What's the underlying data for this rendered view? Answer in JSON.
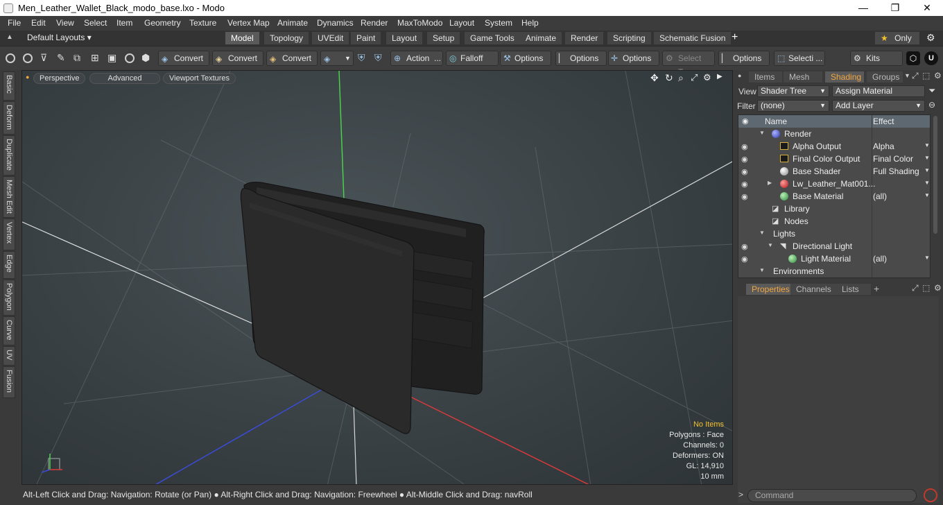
{
  "window": {
    "title": "Men_Leather_Wallet_Black_modo_base.lxo - Modo",
    "minimize": "—",
    "maximize": "❐",
    "close": "✕"
  },
  "menu": [
    "File",
    "Edit",
    "View",
    "Select",
    "Item",
    "Geometry",
    "Texture",
    "Vertex Map",
    "Animate",
    "Dynamics",
    "Render",
    "MaxToModo",
    "Layout",
    "System",
    "Help"
  ],
  "layouts": {
    "dropdown": "Default Layouts ▾",
    "tabs": [
      "Model",
      "Topology",
      "UVEdit",
      "Paint",
      "Layout",
      "Setup",
      "Game Tools",
      "Animate",
      "Render",
      "Scripting",
      "Schematic Fusion"
    ],
    "active": "Model",
    "add": "+",
    "only": "Only",
    "star": "★"
  },
  "toolbar": {
    "convert1": "Convert",
    "convert2": "Convert",
    "convert3": "Convert",
    "action": "Action",
    "action_more": "...",
    "falloff": "Falloff",
    "options1": "Options",
    "options2": "Options",
    "options3": "Options",
    "select_t": "Select T...",
    "options4": "Options",
    "selecti": "Selecti ...",
    "kits": "Kits"
  },
  "left_tabs": [
    "Basic",
    "Deform",
    "Duplicate",
    "Mesh Edit",
    "Vertex",
    "Edge",
    "Polygon",
    "Curve",
    "UV",
    "Fusion"
  ],
  "viewport": {
    "perspective": "Perspective",
    "advanced": "Advanced",
    "textures": "Viewport Textures",
    "info": {
      "no_items": "No Items",
      "polygons": "Polygons : Face",
      "channels": "Channels: 0",
      "deformers": "Deformers: ON",
      "gl": "GL: 14,910",
      "scale": "10 mm"
    }
  },
  "status": "Alt-Left Click and Drag: Navigation: Rotate (or Pan) ● Alt-Right Click and Drag: Navigation: Freewheel ● Alt-Middle Click and Drag: navRoll",
  "right": {
    "tabs": [
      "Items",
      "Mesh ...",
      "Shading",
      "Groups"
    ],
    "active_tab": "Shading",
    "view_label": "View",
    "view_value": "Shader Tree",
    "assign": "Assign Material",
    "filter_label": "Filter",
    "filter_value": "(none)",
    "add_layer": "Add Layer",
    "col_name": "Name",
    "col_effect": "Effect",
    "tree": [
      {
        "name": "Render",
        "effect": ""
      },
      {
        "name": "Alpha Output",
        "effect": "Alpha"
      },
      {
        "name": "Final Color Output",
        "effect": "Final Color"
      },
      {
        "name": "Base Shader",
        "effect": "Full Shading"
      },
      {
        "name": "Lw_Leather_Mat001...",
        "effect": ""
      },
      {
        "name": "Base Material",
        "effect": "(all)"
      },
      {
        "name": "Library",
        "effect": ""
      },
      {
        "name": "Nodes",
        "effect": ""
      },
      {
        "name": "Lights",
        "effect": ""
      },
      {
        "name": "Directional Light",
        "effect": ""
      },
      {
        "name": "Light Material",
        "effect": "(all)"
      },
      {
        "name": "Environments",
        "effect": ""
      }
    ],
    "prop_tabs": [
      "Properties",
      "Channels",
      "Lists"
    ],
    "prop_active": "Properties",
    "prop_add": "+",
    "command_placeholder": "Command"
  }
}
